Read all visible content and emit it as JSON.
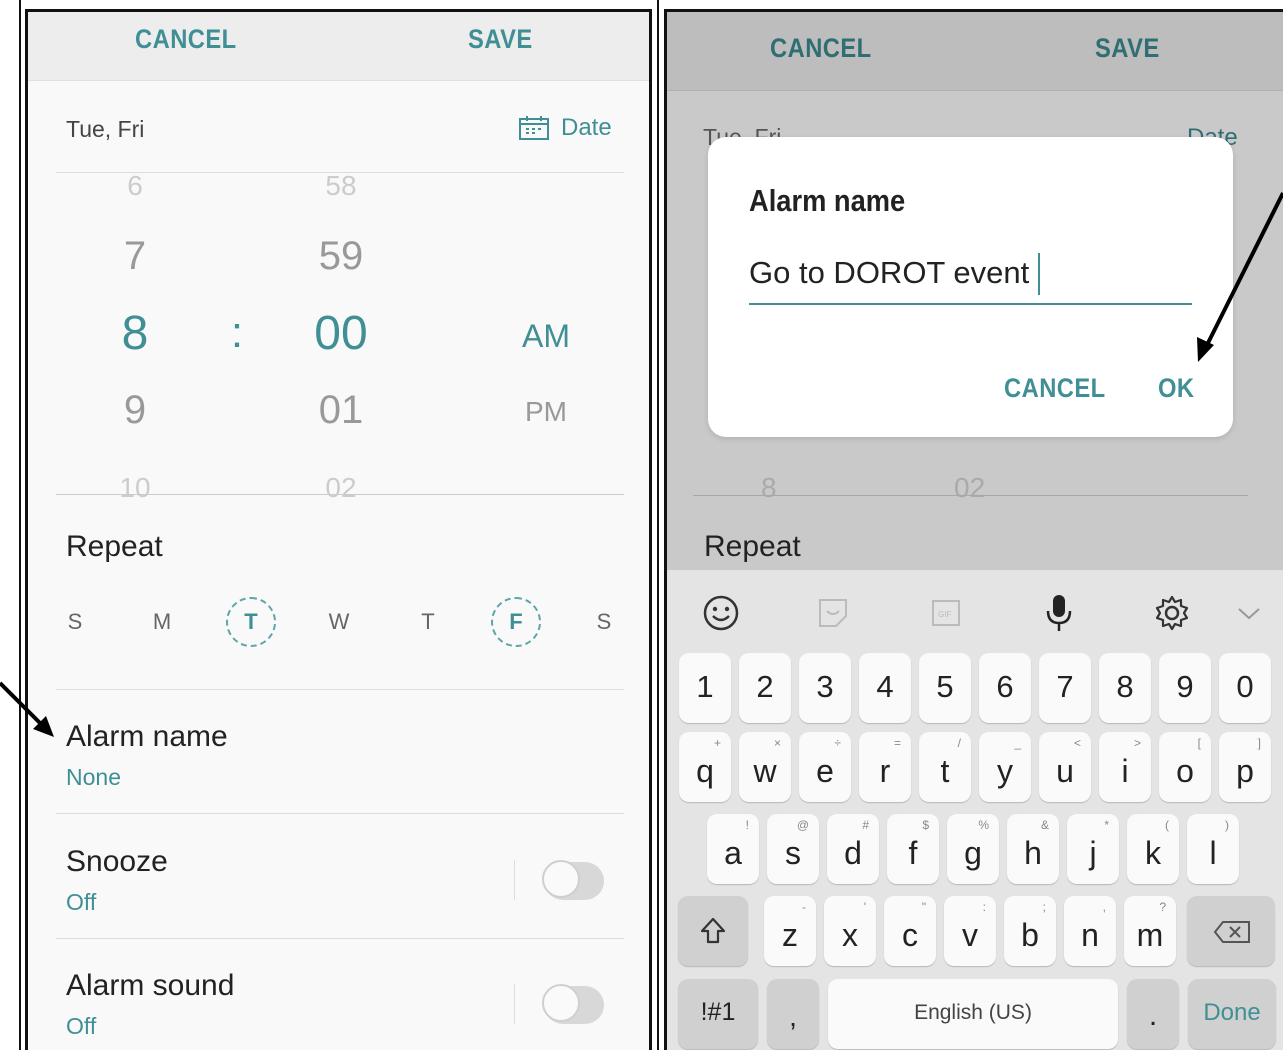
{
  "left": {
    "cancel": "CANCEL",
    "save": "SAVE",
    "date_summary": "Tue, Fri",
    "date_button": "Date",
    "hours": [
      "6",
      "7",
      "8",
      "9",
      "10"
    ],
    "colon": ":",
    "minutes": [
      "58",
      "59",
      "00",
      "01",
      "02"
    ],
    "am": "AM",
    "pm": "PM",
    "repeat_label": "Repeat",
    "days": [
      "S",
      "M",
      "T",
      "W",
      "T",
      "F",
      "S"
    ],
    "selected_days": [
      "T",
      "F"
    ],
    "alarm_name_label": "Alarm name",
    "alarm_name_value": "None",
    "snooze_label": "Snooze",
    "snooze_value": "Off",
    "sound_label": "Alarm sound",
    "sound_value": "Off"
  },
  "right": {
    "cancel": "CANCEL",
    "save": "SAVE",
    "bg_date_summary": "Tue, Fri",
    "bg_date_button": "Date",
    "bg_hour": "8",
    "bg_minute": "02",
    "bg_repeat_label": "Repeat",
    "dialog": {
      "title": "Alarm name",
      "input_value": "Go to DOROT event",
      "cancel": "CANCEL",
      "ok": "OK"
    },
    "keyboard": {
      "numbers": [
        "1",
        "2",
        "3",
        "4",
        "5",
        "6",
        "7",
        "8",
        "9",
        "0"
      ],
      "row1": [
        [
          "q",
          "+"
        ],
        [
          "w",
          "×"
        ],
        [
          "e",
          "÷"
        ],
        [
          "r",
          "="
        ],
        [
          "t",
          "/"
        ],
        [
          "y",
          "_"
        ],
        [
          "u",
          "<"
        ],
        [
          "i",
          ">"
        ],
        [
          "o",
          "["
        ],
        [
          "p",
          "]"
        ]
      ],
      "row2": [
        [
          "a",
          "!"
        ],
        [
          "s",
          "@"
        ],
        [
          "d",
          "#"
        ],
        [
          "f",
          "$"
        ],
        [
          "g",
          "%"
        ],
        [
          "h",
          "&"
        ],
        [
          "j",
          "*"
        ],
        [
          "k",
          "("
        ],
        [
          "l",
          ")"
        ]
      ],
      "row3": [
        [
          "z",
          "-"
        ],
        [
          "x",
          "'"
        ],
        [
          "c",
          "\""
        ],
        [
          "v",
          ":"
        ],
        [
          "b",
          ";"
        ],
        [
          "n",
          ","
        ],
        [
          "m",
          "?"
        ]
      ],
      "sym_key": "!#1",
      "comma_key": ",",
      "space_label": "English (US)",
      "period_key": ".",
      "done_key": "Done"
    }
  },
  "colors": {
    "accent": "#3f8f95",
    "panel_bg": "#f9f9f9",
    "dim_bg": "#c9c9c9",
    "keyboard_bg": "#e4e4e4"
  }
}
